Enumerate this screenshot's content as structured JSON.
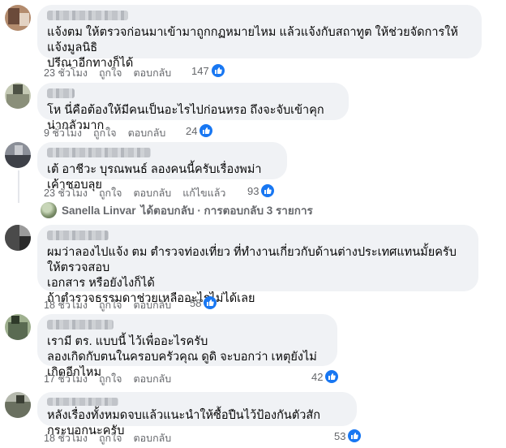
{
  "comments": [
    {
      "text": "แจ้งตม ให้ตรวจก่อนมาเข้ามาถูกกฏหมายไหม แล้วแจ้งกับสถาทูต ให้ช่วยจัดการให้ แจ้งมูลนิธิ\nปรีณาอีกทางก็ได้",
      "time": "23 ชั่วโมง",
      "like": "ถูกใจ",
      "reply": "ตอบกลับ",
      "count": "147",
      "avatar": [
        "#6b4a3a",
        "#b38b6d",
        "#e3d2c2"
      ]
    },
    {
      "text": "โห นี่คือต้องให้มีคนเป็นอะไรไปก่อนหรอ ถึงจะจับเข้าคุก น่ากลัวมาก",
      "time": "9 ชั่วโมง",
      "like": "ถูกใจ",
      "reply": "ตอบกลับ",
      "count": "24",
      "avatar": [
        "#8a8f7a",
        "#c4c9b4",
        "#4d5245"
      ]
    },
    {
      "text": "เต้ อาชีวะ บุรณพนธ์ ลองคนนี้ครับเรื่องพม่าเค้าชอบลุย",
      "time": "23 ชั่วโมง",
      "like": "ถูกใจ",
      "reply": "ตอบกลับ",
      "edited": "แก้ไขแล้ว",
      "count": "93",
      "avatar": [
        "#3e4148",
        "#8b8f98",
        "#c9cbd0"
      ]
    },
    {
      "text": "ผมว่าลองไปแจ้ง ตม ตำรวจท่องเที่ยว ที่ทำงานเกี่ยวกับด้านต่างประเทศแทนมั้ยครับ ให้ตรวจสอบ\nเอกสาร หรือยังไงก็ได้\nถ้าตำรวจธรรมดาช่วยเหลืออะไรไม่ได้เลย",
      "time": "18 ชั่วโมง",
      "like": "ถูกใจ",
      "reply": "ตอบกลับ",
      "count": "58",
      "avatar": [
        "#4a4a4a",
        "#9a9a9a",
        "#2a2a2a"
      ]
    },
    {
      "text": "เรามี ตร. แบบนี้ ไว้เพื่ออะไรครับ\nลองเกิดกับตนในครอบครัวคุณ ดูดิ จะบอกว่า เหตุยังไม่เกิดอีกไหม",
      "time": "17 ชั่วโมง",
      "like": "ถูกใจ",
      "reply": "ตอบกลับ",
      "count": "42",
      "avatar": [
        "#5a6b52",
        "#9fb08f",
        "#2f3a2a"
      ]
    },
    {
      "text": "หลังเรื่องทั้งหมดจบแล้วแนะนำให้ซื้อปืนไว้ป้องกันตัวสักกระบอกนะครับ",
      "time": "18 ชั่วโมง",
      "like": "ถูกใจ",
      "reply": "ตอบกลับ",
      "count": "53",
      "avatar": [
        "#6a7060",
        "#b5b9ad",
        "#3a3e34"
      ]
    }
  ],
  "reply_summary": {
    "name": "Sanella Linvar",
    "text": "ได้ตอบกลับ · การตอบกลับ 3 รายการ"
  },
  "colors": {
    "like_blue": "#1877f2",
    "bubble": "#f0f2f5",
    "meta": "#65676b"
  }
}
